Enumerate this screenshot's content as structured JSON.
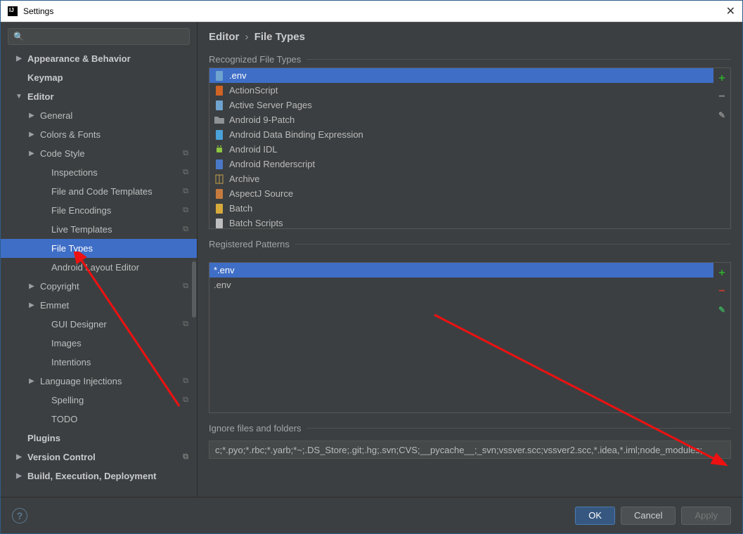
{
  "window": {
    "title": "Settings"
  },
  "search": {
    "placeholder": ""
  },
  "sidebar": {
    "items": [
      {
        "label": "Appearance & Behavior",
        "depth": 1,
        "arrow": "closed",
        "bold": true
      },
      {
        "label": "Keymap",
        "depth": 1,
        "arrow": "none",
        "bold": true
      },
      {
        "label": "Editor",
        "depth": 1,
        "arrow": "open",
        "bold": true
      },
      {
        "label": "General",
        "depth": 2,
        "arrow": "closed",
        "bold": false
      },
      {
        "label": "Colors & Fonts",
        "depth": 2,
        "arrow": "closed",
        "bold": false
      },
      {
        "label": "Code Style",
        "depth": 2,
        "arrow": "closed",
        "bold": false,
        "indicator": true
      },
      {
        "label": "Inspections",
        "depth": 3,
        "arrow": "none",
        "bold": false,
        "indicator": true
      },
      {
        "label": "File and Code Templates",
        "depth": 3,
        "arrow": "none",
        "bold": false,
        "indicator": true
      },
      {
        "label": "File Encodings",
        "depth": 3,
        "arrow": "none",
        "bold": false,
        "indicator": true
      },
      {
        "label": "Live Templates",
        "depth": 3,
        "arrow": "none",
        "bold": false,
        "indicator": true
      },
      {
        "label": "File Types",
        "depth": 3,
        "arrow": "none",
        "bold": false,
        "selected": true
      },
      {
        "label": "Android Layout Editor",
        "depth": 3,
        "arrow": "none",
        "bold": false
      },
      {
        "label": "Copyright",
        "depth": 2,
        "arrow": "closed",
        "bold": false,
        "indicator": true
      },
      {
        "label": "Emmet",
        "depth": 2,
        "arrow": "closed",
        "bold": false
      },
      {
        "label": "GUI Designer",
        "depth": 3,
        "arrow": "none",
        "bold": false,
        "indicator": true
      },
      {
        "label": "Images",
        "depth": 3,
        "arrow": "none",
        "bold": false
      },
      {
        "label": "Intentions",
        "depth": 3,
        "arrow": "none",
        "bold": false
      },
      {
        "label": "Language Injections",
        "depth": 2,
        "arrow": "closed",
        "bold": false,
        "indicator": true
      },
      {
        "label": "Spelling",
        "depth": 3,
        "arrow": "none",
        "bold": false,
        "indicator": true
      },
      {
        "label": "TODO",
        "depth": 3,
        "arrow": "none",
        "bold": false
      },
      {
        "label": "Plugins",
        "depth": 1,
        "arrow": "none",
        "bold": true
      },
      {
        "label": "Version Control",
        "depth": 1,
        "arrow": "closed",
        "bold": true,
        "indicator": true
      },
      {
        "label": "Build, Execution, Deployment",
        "depth": 1,
        "arrow": "closed",
        "bold": true
      }
    ]
  },
  "breadcrumb": {
    "p1": "Editor",
    "p2": "File Types"
  },
  "recognized": {
    "label": "Recognized File Types",
    "items": [
      {
        "label": ".env",
        "icon": "file",
        "color": "#6fa3d0",
        "selected": true
      },
      {
        "label": "ActionScript",
        "icon": "as",
        "color": "#d06325"
      },
      {
        "label": "Active Server Pages",
        "icon": "asp",
        "color": "#6fa3d0"
      },
      {
        "label": "Android 9-Patch",
        "icon": "folder",
        "color": "#8e9294"
      },
      {
        "label": "Android Data Binding Expression",
        "icon": "db",
        "color": "#4aa2d8"
      },
      {
        "label": "Android IDL",
        "icon": "android",
        "color": "#8dc63f"
      },
      {
        "label": "Android Renderscript",
        "icon": "rs",
        "color": "#4a78c8"
      },
      {
        "label": "Archive",
        "icon": "archive",
        "color": "#c2a24a"
      },
      {
        "label": "AspectJ Source",
        "icon": "aj",
        "color": "#c77b3e"
      },
      {
        "label": "Batch",
        "icon": "batch",
        "color": "#d6a93b"
      },
      {
        "label": "Batch Scripts",
        "icon": "batchscript",
        "color": "#bcbebf"
      }
    ]
  },
  "patterns": {
    "label": "Registered Patterns",
    "items": [
      {
        "label": "*.env",
        "selected": true
      },
      {
        "label": ".env"
      }
    ]
  },
  "ignore": {
    "label": "Ignore files and folders",
    "value": "c;*.pyo;*.rbc;*.yarb;*~;.DS_Store;.git;.hg;.svn;CVS;__pycache__;_svn;vssver.scc;vssver2.scc,*.idea,*.iml;node_modules;"
  },
  "footer": {
    "ok": "OK",
    "cancel": "Cancel",
    "apply": "Apply"
  },
  "colors": {
    "selection": "#3f6ec6"
  }
}
